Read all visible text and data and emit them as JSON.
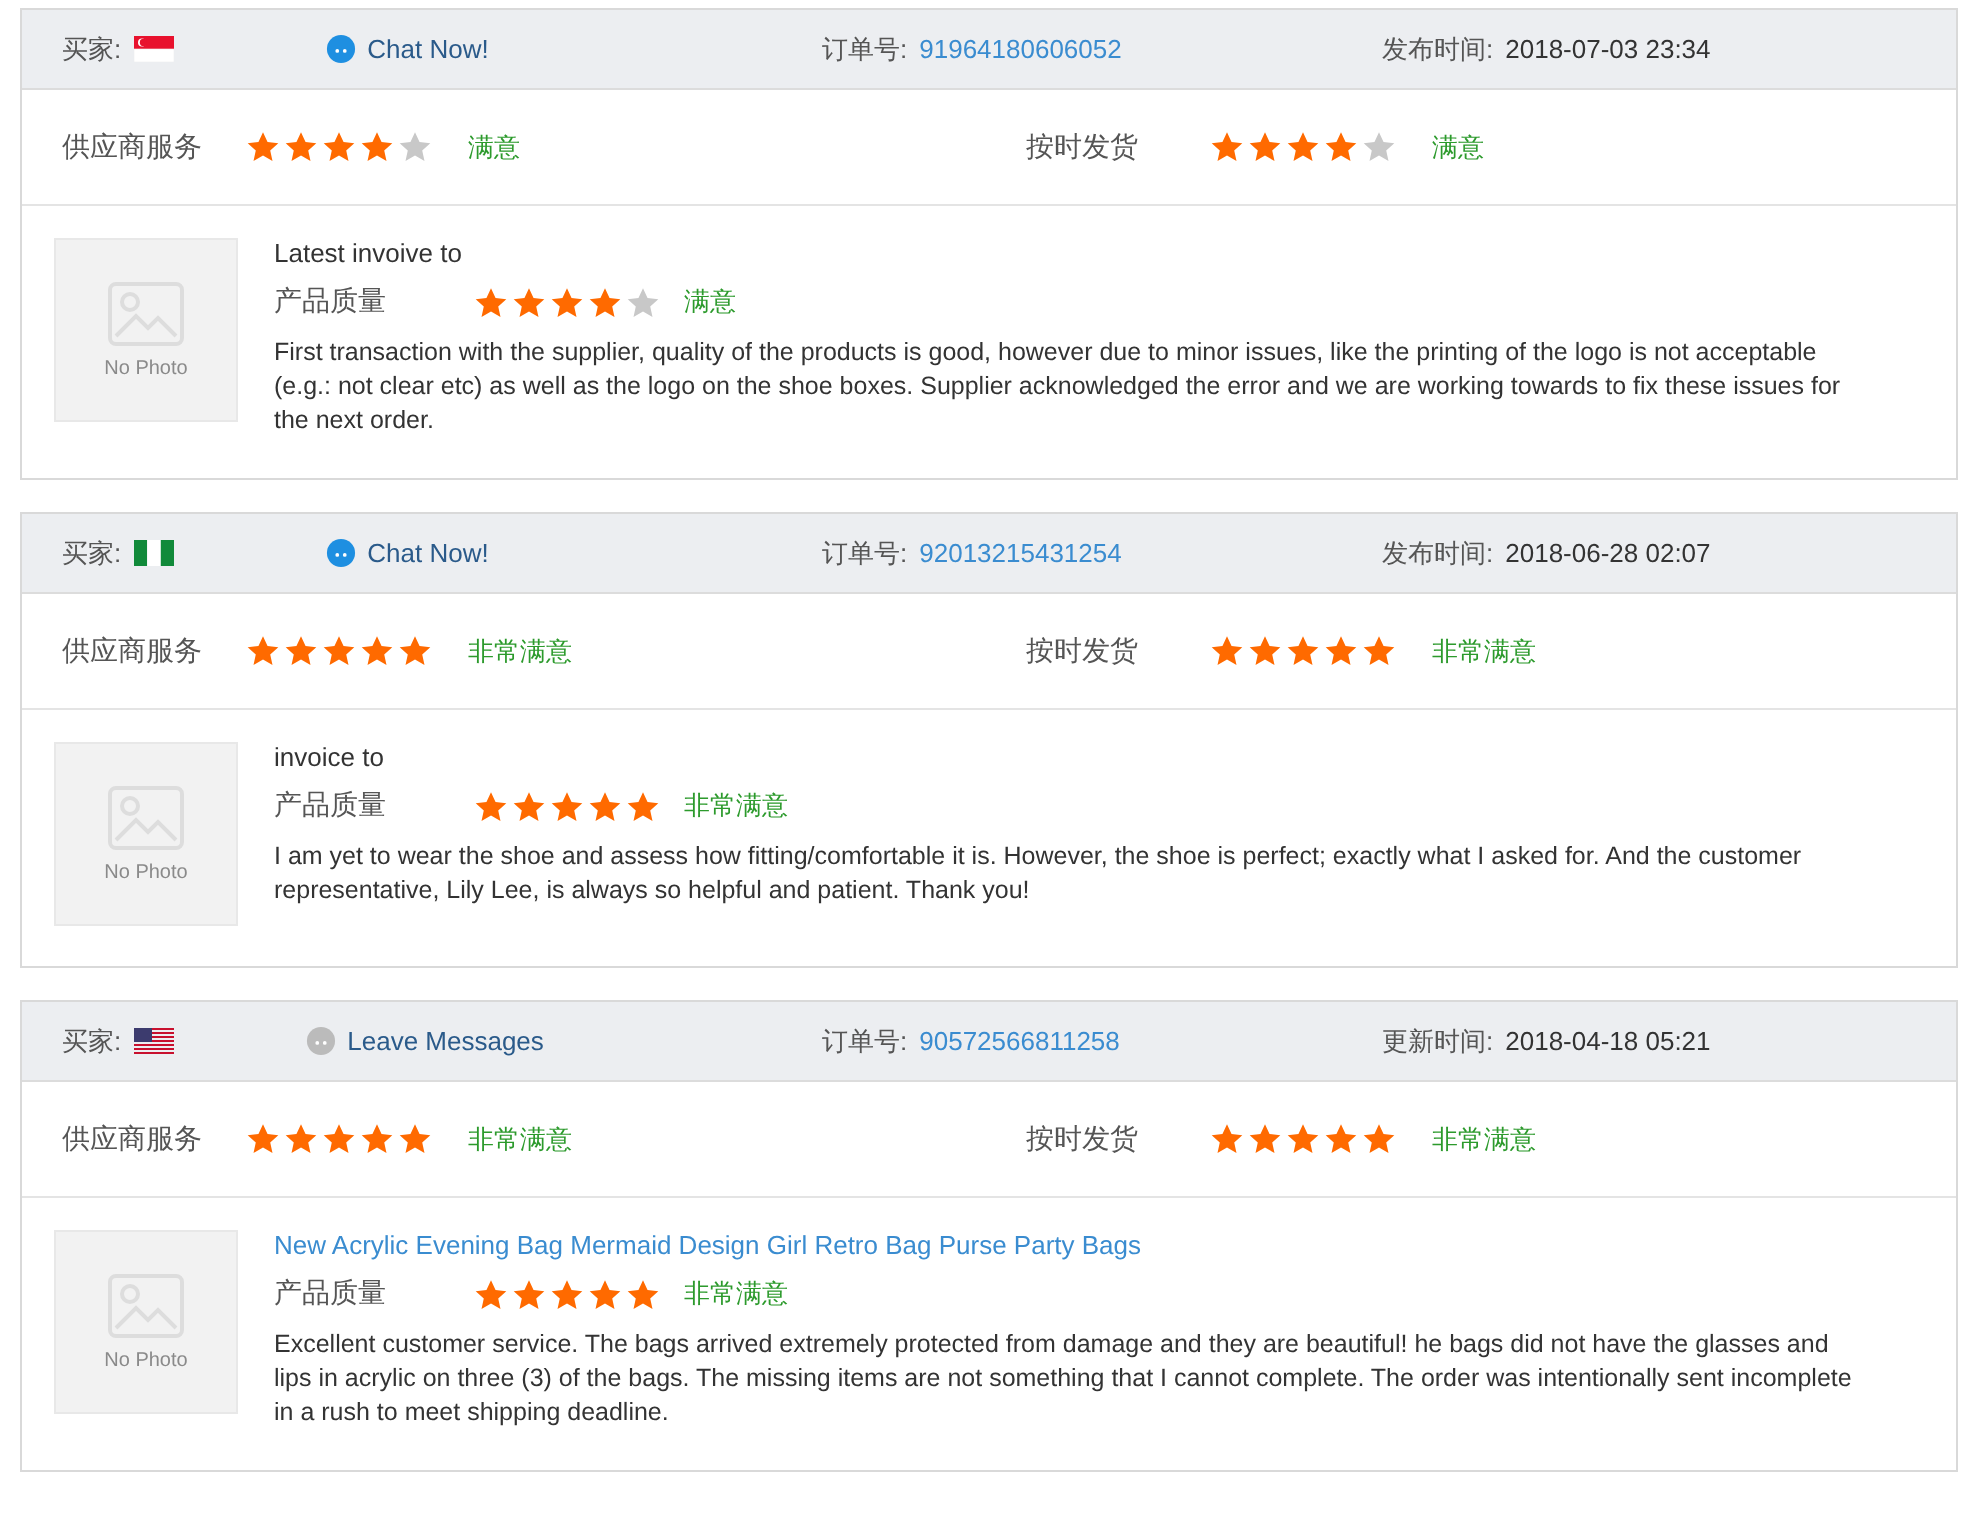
{
  "reviews": [
    {
      "buyer_label": "买家:",
      "flag": {
        "kind": "sg"
      },
      "contact": {
        "label": "Chat Now!",
        "online": true
      },
      "order_label": "订单号:",
      "order_no": "91964180606052",
      "time_label": "发布时间:",
      "time": "2018-07-03 23:34",
      "ratings": [
        {
          "label": "供应商服务",
          "stars": 4,
          "verdict": "满意"
        },
        {
          "label": "按时发货",
          "stars": 4,
          "verdict": "满意"
        }
      ],
      "title": {
        "text": "Latest invoive to",
        "kind": "text"
      },
      "quality": {
        "label": "产品质量",
        "stars": 4,
        "verdict": "满意"
      },
      "photo": "No Photo",
      "comment": "First transaction with the supplier, quality of the products is good, however due to minor issues, like the printing of the logo is not acceptable (e.g.: not clear etc) as well as the logo on the shoe boxes. Supplier acknowledged the error and we are working towards to fix these issues for the next order."
    },
    {
      "buyer_label": "买家:",
      "flag": {
        "kind": "ng"
      },
      "contact": {
        "label": "Chat Now!",
        "online": true
      },
      "order_label": "订单号:",
      "order_no": "92013215431254",
      "time_label": "发布时间:",
      "time": "2018-06-28 02:07",
      "ratings": [
        {
          "label": "供应商服务",
          "stars": 5,
          "verdict": "非常满意"
        },
        {
          "label": "按时发货",
          "stars": 5,
          "verdict": "非常满意"
        }
      ],
      "title": {
        "text": "invoice to",
        "kind": "text"
      },
      "quality": {
        "label": "产品质量",
        "stars": 5,
        "verdict": "非常满意"
      },
      "photo": "No Photo",
      "comment": "I am yet to wear the shoe and assess how fitting/comfortable it is. However, the shoe is perfect; exactly what I asked for. And the customer representative, Lily Lee, is always so helpful and patient. Thank you!"
    },
    {
      "buyer_label": "买家:",
      "flag": {
        "kind": "us"
      },
      "contact": {
        "label": "Leave Messages",
        "online": false
      },
      "order_label": "订单号:",
      "order_no": "90572566811258",
      "time_label": "更新时间:",
      "time": "2018-04-18 05:21",
      "ratings": [
        {
          "label": "供应商服务",
          "stars": 5,
          "verdict": "非常满意"
        },
        {
          "label": "按时发货",
          "stars": 5,
          "verdict": "非常满意"
        }
      ],
      "title": {
        "text": "New Acrylic Evening Bag Mermaid Design Girl Retro Bag Purse Party Bags",
        "kind": "link"
      },
      "quality": {
        "label": "产品质量",
        "stars": 5,
        "verdict": "非常满意"
      },
      "photo": "No Photo",
      "comment": "Excellent customer service. The bags arrived extremely protected from damage and they are beautiful! he bags did not have the glasses and lips in acrylic on three (3) of the bags. The missing items are not something that I cannot complete. The order was intentionally sent incomplete in a rush to meet shipping deadline."
    }
  ]
}
